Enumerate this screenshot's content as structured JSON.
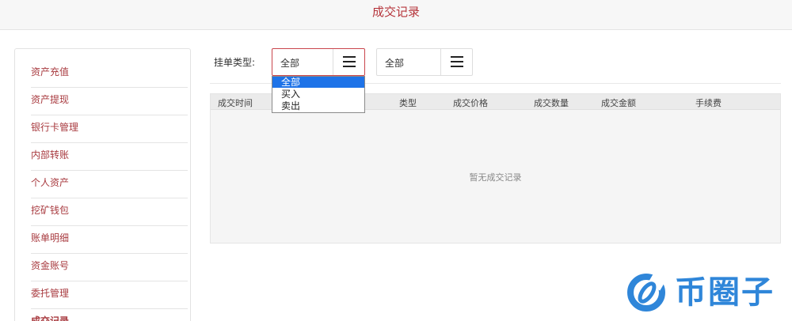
{
  "header": {
    "title": "成交记录"
  },
  "sidebar": {
    "items": [
      {
        "label": "资产充值"
      },
      {
        "label": "资产提现"
      },
      {
        "label": "银行卡管理"
      },
      {
        "label": "内部转账"
      },
      {
        "label": "个人资产"
      },
      {
        "label": "挖矿钱包"
      },
      {
        "label": "账单明细"
      },
      {
        "label": "资金账号"
      },
      {
        "label": "委托管理"
      },
      {
        "label": "成交记录"
      }
    ]
  },
  "filter": {
    "label": "挂单类型:",
    "select1_value": "全部",
    "select2_value": "全部",
    "dropdown_options": [
      "全部",
      "买入",
      "卖出"
    ]
  },
  "table": {
    "columns": [
      "成交时间",
      "类型",
      "成交价格",
      "成交数量",
      "成交金额",
      "手续费"
    ],
    "empty_text": "暂无成交记录"
  },
  "watermark": {
    "text": "币圈子"
  },
  "colors": {
    "accent": "#b5343b",
    "selected": "#1e73e8",
    "logo": "#2f86d9"
  }
}
